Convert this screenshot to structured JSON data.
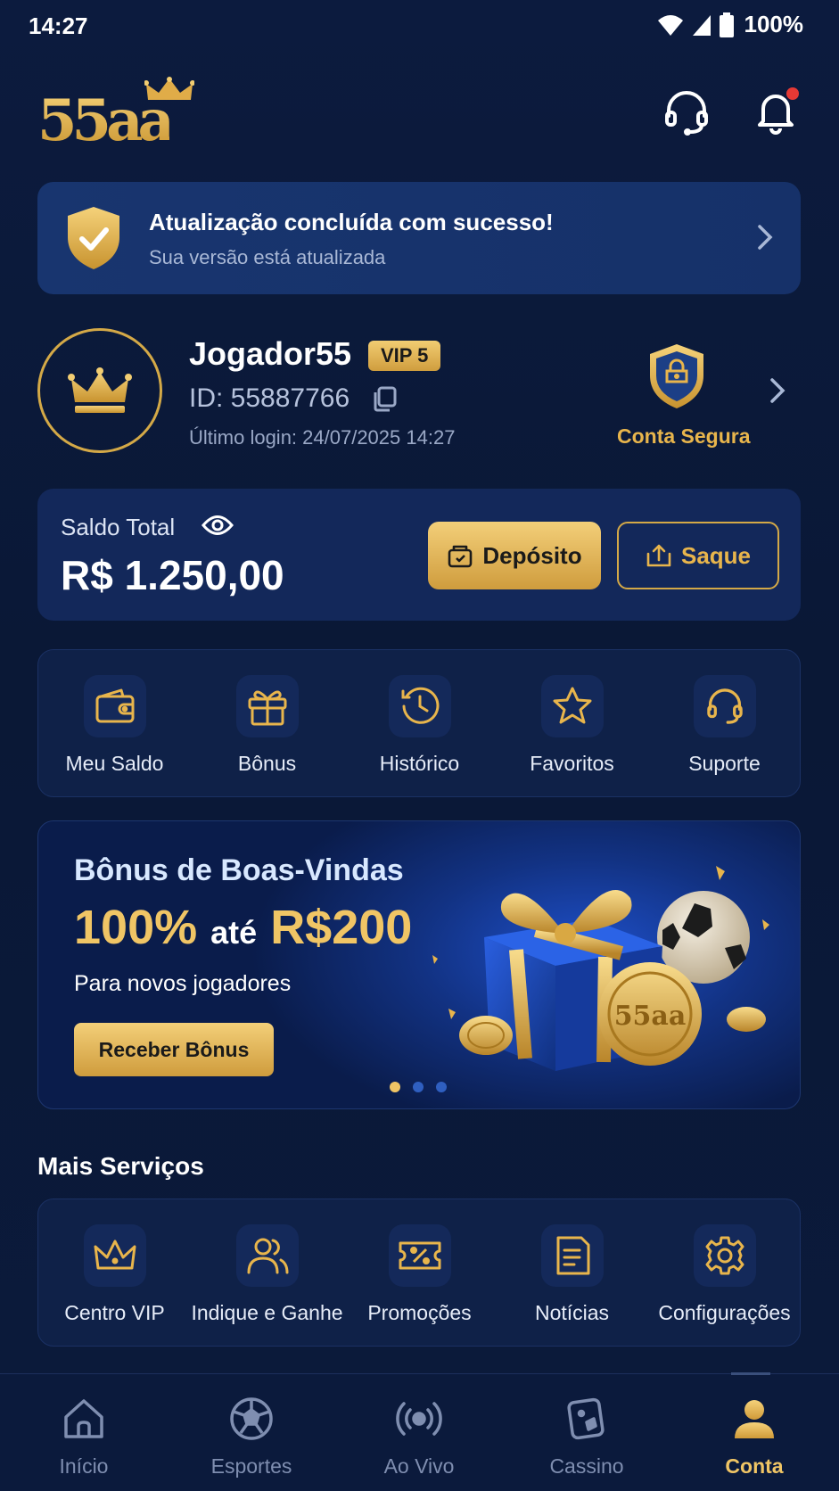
{
  "status_bar": {
    "time": "14:27",
    "battery": "100%"
  },
  "header": {
    "logo_text": "55aa"
  },
  "update_banner": {
    "title": "Atualização concluída com sucesso!",
    "subtitle": "Sua versão está atualizada"
  },
  "profile": {
    "username": "Jogador55",
    "vip": "VIP 5",
    "id": "ID: 55887766",
    "last_login": "Último login: 24/07/2025 14:27",
    "secure_label": "Conta Segura"
  },
  "balance": {
    "label": "Saldo Total",
    "value": "R$ 1.250,00",
    "deposit_label": "Depósito",
    "withdraw_label": "Saque"
  },
  "quick_actions": [
    {
      "label": "Meu Saldo",
      "icon": "wallet-icon"
    },
    {
      "label": "Bônus",
      "icon": "gift-icon"
    },
    {
      "label": "Histórico",
      "icon": "history-icon"
    },
    {
      "label": "Favoritos",
      "icon": "star-icon"
    },
    {
      "label": "Suporte",
      "icon": "headset-icon"
    }
  ],
  "promo": {
    "title": "Bônus de Boas-Vindas",
    "percent": "100%",
    "ate": "até",
    "amount": "R$200",
    "subtitle": "Para novos jogadores",
    "button": "Receber Bônus",
    "coin_text": "55aa"
  },
  "more_services": {
    "title": "Mais Serviços",
    "items": [
      {
        "label": "Centro VIP",
        "icon": "crown-icon"
      },
      {
        "label": "Indique e Ganhe",
        "icon": "users-icon"
      },
      {
        "label": "Promoções",
        "icon": "ticket-percent-icon"
      },
      {
        "label": "Notícias",
        "icon": "news-icon"
      },
      {
        "label": "Configurações",
        "icon": "gear-icon"
      }
    ]
  },
  "bottom_nav": [
    {
      "label": "Início",
      "icon": "home-icon"
    },
    {
      "label": "Esportes",
      "icon": "soccer-ball-icon"
    },
    {
      "label": "Ao Vivo",
      "icon": "live-broadcast-icon"
    },
    {
      "label": "Cassino",
      "icon": "dice-card-icon"
    },
    {
      "label": "Conta",
      "icon": "user-icon",
      "active": true
    }
  ],
  "colors": {
    "gold": "#f0c565",
    "background": "#0b1a3a",
    "card": "#13285a"
  }
}
